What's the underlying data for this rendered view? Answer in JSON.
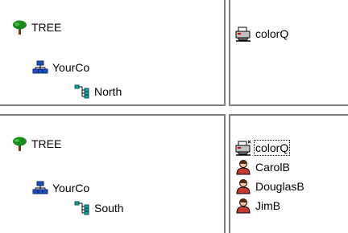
{
  "top": {
    "tree": {
      "root": "TREE",
      "org": "YourCo",
      "unit": "North"
    },
    "objects": [
      "colorQ"
    ]
  },
  "bottom": {
    "tree": {
      "root": "TREE",
      "org": "YourCo",
      "unit": "South"
    },
    "objects": [
      "colorQ",
      "CarolB",
      "DouglasB",
      "JimB"
    ]
  },
  "icons": {
    "tree": "tree-icon",
    "organization": "organization-icon",
    "organizational_unit": "organizational-unit-icon",
    "printer_queue": "printer-queue-icon",
    "user": "user-icon"
  },
  "colors": {
    "pane_border": "#808080",
    "tree_green": "#1a8a1a",
    "user_red": "#c83a2a"
  }
}
